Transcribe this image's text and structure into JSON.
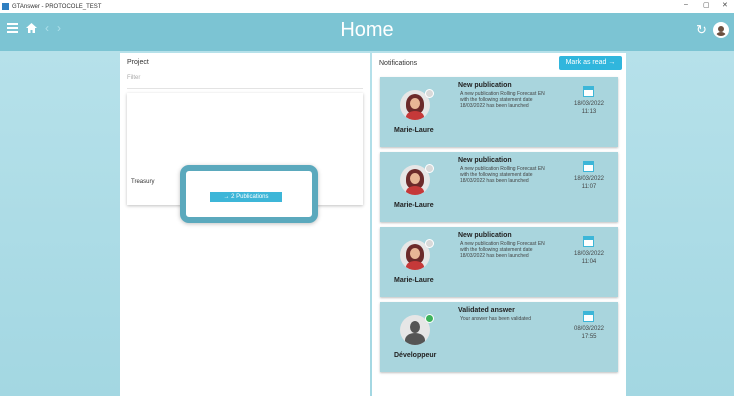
{
  "window": {
    "title": "GTAnswer - PROTOCOLE_TEST",
    "minimize": "–",
    "maximize": "▢",
    "close": "✕"
  },
  "topbar": {
    "title": "Home",
    "back": "‹",
    "forward": "›"
  },
  "project": {
    "header": "Project",
    "filter_placeholder": "Filter",
    "item_name": "Treasury",
    "publications_button": "→ 2 Publications"
  },
  "notifications": {
    "header": "Notifications",
    "mark_read": "Mark as read →",
    "items": [
      {
        "author": "Marie-Laure",
        "title": "New publication",
        "message": "A new publication Rolling Forecast EN with the following statement date 18/03/2022 has been launched",
        "date": "18/03/2022",
        "time": "11:13"
      },
      {
        "author": "Marie-Laure",
        "title": "New publication",
        "message": "A new publication Rolling Forecast EN with the following statement date 18/03/2022 has been launched",
        "date": "18/03/2022",
        "time": "11:07"
      },
      {
        "author": "Marie-Laure",
        "title": "New publication",
        "message": "A new publication Rolling Forecast EN with the following statement date 18/03/2022 has been launched",
        "date": "18/03/2022",
        "time": "11:04"
      },
      {
        "author": "Développeur",
        "title": "Validated answer",
        "message": "Your answer has been validated",
        "date": "08/03/2022",
        "time": "17:55"
      }
    ]
  }
}
